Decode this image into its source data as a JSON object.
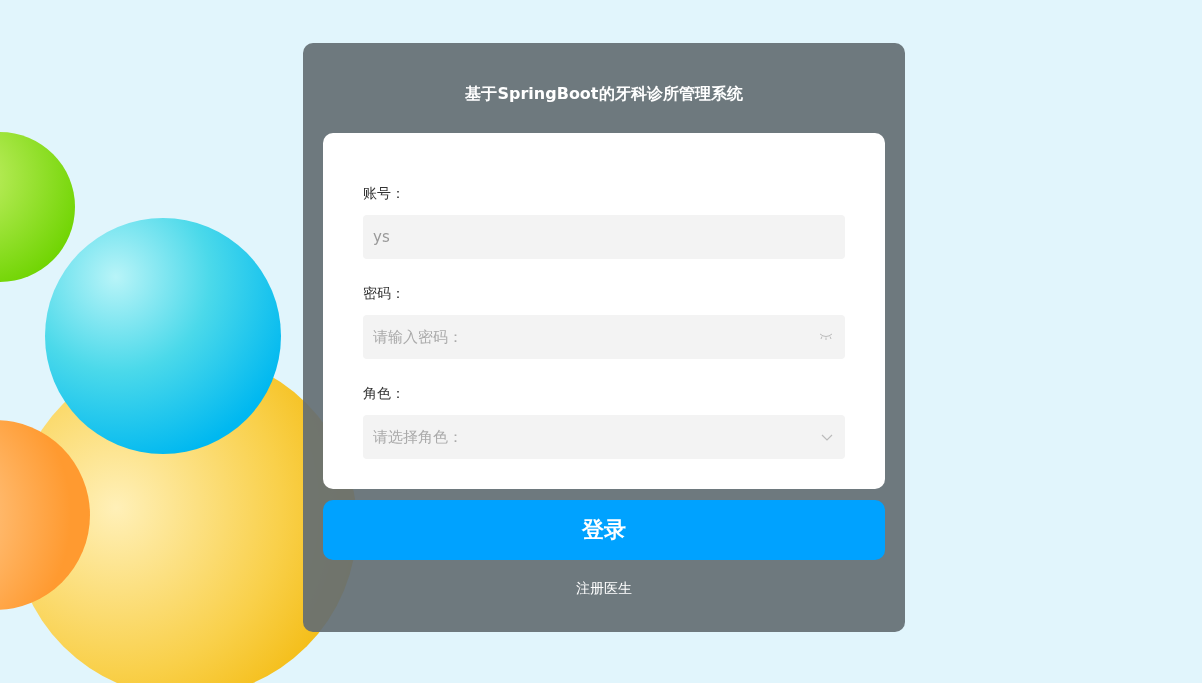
{
  "title": "基于SpringBoot的牙科诊所管理系统",
  "fields": [
    {
      "kind": "text",
      "label": "账号：",
      "value": "ys"
    },
    {
      "kind": "password",
      "label": "密码：",
      "placeholder": "请输入密码："
    },
    {
      "kind": "select",
      "label": "角色：",
      "placeholder": "请选择角色："
    }
  ],
  "login_button": "登录",
  "register_link": "注册医生"
}
